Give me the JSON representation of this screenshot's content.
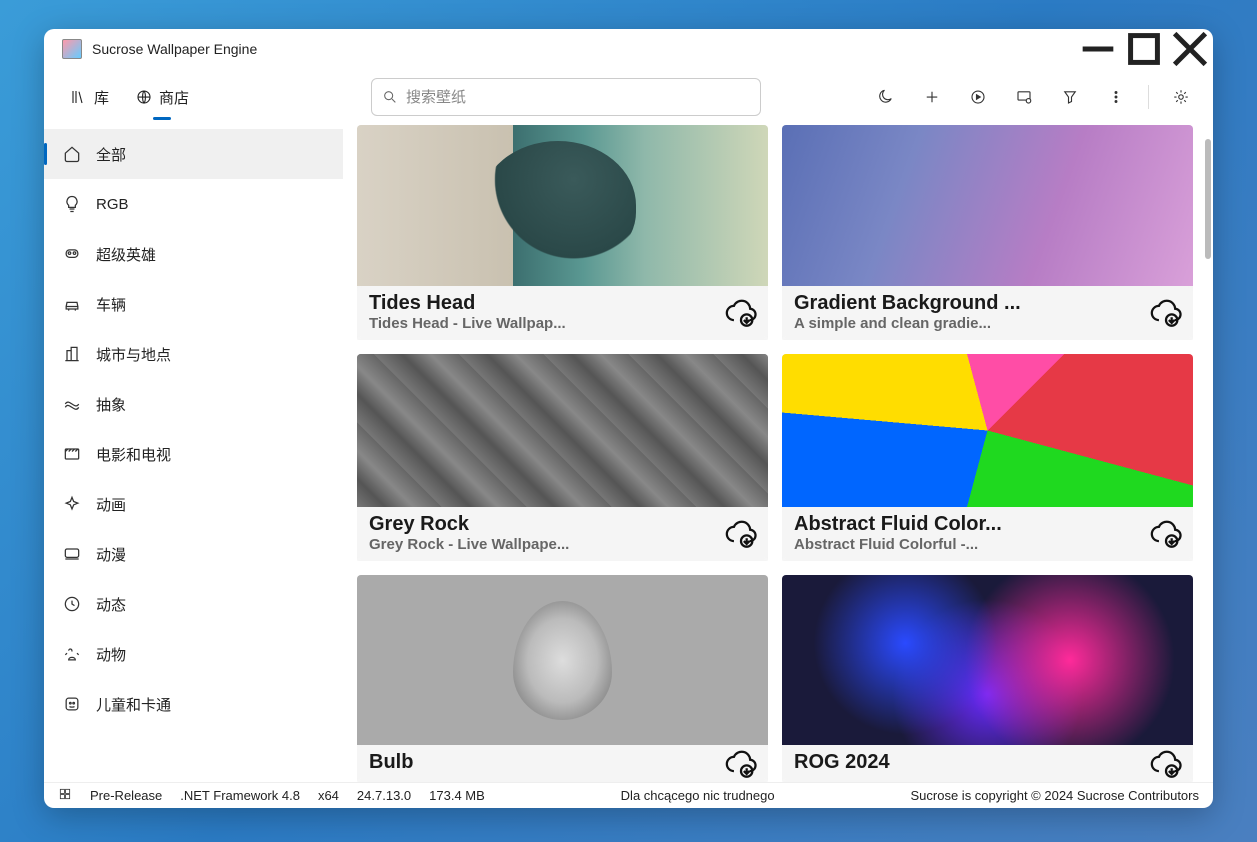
{
  "app": {
    "title": "Sucrose Wallpaper Engine"
  },
  "tabs": {
    "library": "库",
    "store": "商店"
  },
  "search": {
    "placeholder": "搜索壁纸"
  },
  "sidebar": [
    {
      "label": "全部"
    },
    {
      "label": "RGB"
    },
    {
      "label": "超级英雄"
    },
    {
      "label": "车辆"
    },
    {
      "label": "城市与地点"
    },
    {
      "label": "抽象"
    },
    {
      "label": "电影和电视"
    },
    {
      "label": "动画"
    },
    {
      "label": "动漫"
    },
    {
      "label": "动态"
    },
    {
      "label": "动物"
    },
    {
      "label": "儿童和卡通"
    }
  ],
  "cards": [
    {
      "title": "Tides Head",
      "sub": "Tides Head - Live Wallpap..."
    },
    {
      "title": "Gradient Background ...",
      "sub": "A simple and clean gradie..."
    },
    {
      "title": "Grey Rock",
      "sub": "Grey Rock - Live Wallpape..."
    },
    {
      "title": "Abstract Fluid Color...",
      "sub": "Abstract Fluid Colorful -..."
    },
    {
      "title": "Bulb",
      "sub": ""
    },
    {
      "title": "ROG 2024",
      "sub": ""
    }
  ],
  "status": {
    "release": "Pre-Release",
    "framework": ".NET Framework 4.8",
    "arch": "x64",
    "version": "24.7.13.0",
    "mem": "173.4 MB",
    "quote": "Dla chcącego nic trudnego",
    "copyright": "Sucrose is copyright © 2024 Sucrose Contributors"
  }
}
